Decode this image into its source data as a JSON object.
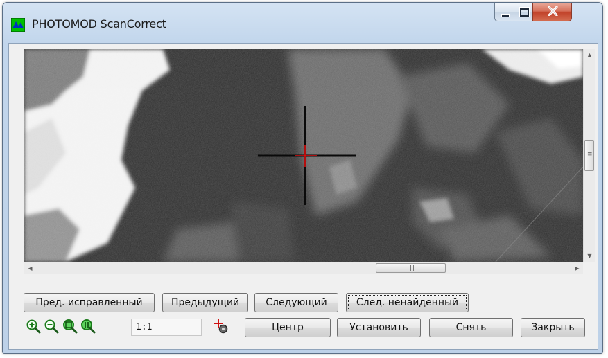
{
  "window": {
    "title": "PHOTOMOD ScanCorrect"
  },
  "title_buttons": {
    "minimize": "minimize-icon",
    "maximize": "maximize-icon",
    "close": "close-icon"
  },
  "nav_buttons": {
    "prev_corrected": "Пред. исправленный",
    "previous": "Предыдущий",
    "next": "Следующий",
    "next_not_found": "След. ненайденный"
  },
  "toolbar": {
    "zoom_value": "1:1",
    "icons": [
      "zoom-in-icon",
      "zoom-out-icon",
      "zoom-fit-icon",
      "zoom-actual-icon",
      "cross-settings-icon"
    ]
  },
  "action_buttons": {
    "center": "Центр",
    "set": "Установить",
    "remove": "Снять",
    "close": "Закрыть"
  },
  "scrollbars": {
    "vertical_position": 0.5,
    "horizontal_position": 0.73
  }
}
